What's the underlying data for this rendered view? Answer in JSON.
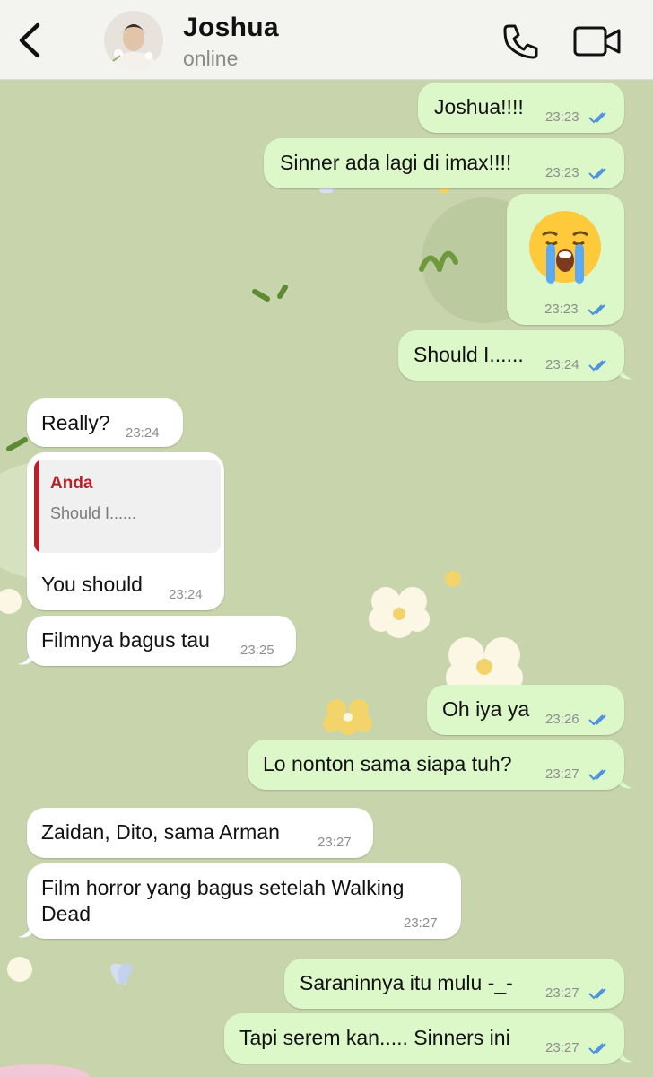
{
  "header": {
    "contact_name": "Joshua",
    "status": "online",
    "back_icon": "chevron-left-icon",
    "call_icon": "phone-icon",
    "video_icon": "video-camera-icon"
  },
  "colors": {
    "outgoing_bubble": "#dcf8c9",
    "incoming_bubble": "#ffffff",
    "read_ticks": "#4a90e2",
    "reply_accent": "#b2232b",
    "wallpaper": "#c7d4ac"
  },
  "messages": [
    {
      "dir": "out",
      "text": "Joshua!!!!",
      "time": "23:23",
      "read": true
    },
    {
      "dir": "out",
      "text": "Sinner ada lagi di imax!!!!",
      "time": "23:23",
      "read": true
    },
    {
      "dir": "out",
      "emoji": "loudly-crying-face",
      "time": "23:23",
      "read": true
    },
    {
      "dir": "out",
      "text": "Should I......",
      "time": "23:24",
      "read": true
    },
    {
      "dir": "in",
      "text": "Really?",
      "time": "23:24"
    },
    {
      "dir": "in",
      "reply_to": {
        "author": "Anda",
        "text": "Should I......"
      },
      "text": "You should",
      "time": "23:24"
    },
    {
      "dir": "in",
      "text": "Filmnya bagus tau",
      "time": "23:25"
    },
    {
      "dir": "out",
      "text": "Oh iya ya",
      "time": "23:26",
      "read": true
    },
    {
      "dir": "out",
      "text": "Lo nonton sama siapa tuh?",
      "time": "23:27",
      "read": true
    },
    {
      "dir": "in",
      "text": "Zaidan, Dito, sama Arman",
      "time": "23:27"
    },
    {
      "dir": "in",
      "text_lines": [
        "Film horror yang bagus setelah Walking",
        "Dead"
      ],
      "time": "23:27"
    },
    {
      "dir": "out",
      "text": "Saraninnya itu mulu -_-",
      "time": "23:27",
      "read": true
    },
    {
      "dir": "out",
      "text": "Tapi serem kan..... Sinners ini",
      "time": "23:27",
      "read": true
    }
  ]
}
